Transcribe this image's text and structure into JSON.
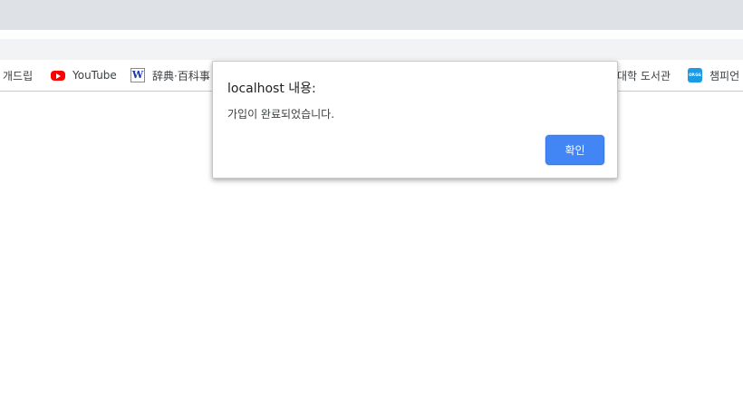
{
  "bookmarks_bar": {
    "items": [
      {
        "label": "개드립",
        "icon": "favicon-none"
      },
      {
        "label": "YouTube",
        "icon": "youtube-icon"
      },
      {
        "label": "辞典·百科事",
        "icon": "w-icon"
      },
      {
        "label": "대학 도서관",
        "icon": "favicon-none"
      },
      {
        "label": "챔피언",
        "icon": "champion-icon"
      }
    ],
    "w_icon_glyph": "W",
    "champion_icon_glyph": "OP.GG"
  },
  "alert_dialog": {
    "title": "localhost 내용:",
    "message": "가입이 완료되었습니다.",
    "ok_label": "확인",
    "accent_color": "#4285f4"
  }
}
